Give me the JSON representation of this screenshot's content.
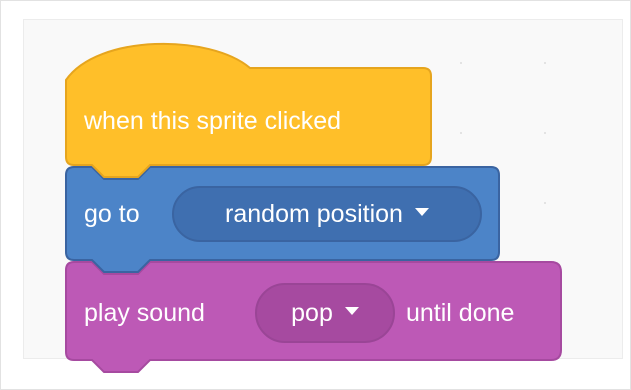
{
  "workspace": {
    "background": "#f9f9f9"
  },
  "script": {
    "hat_block": {
      "label": "when this sprite clicked",
      "color": "#ffbf29",
      "category": "events"
    },
    "goto_block": {
      "label": "go to",
      "dropdown_value": "random position",
      "color": "#4c84c8",
      "category": "motion"
    },
    "sound_block": {
      "label_before": "play sound",
      "dropdown_value": "pop",
      "label_after": "until done",
      "color": "#bd59b6",
      "category": "sound"
    }
  },
  "icons": {
    "dropdown": "dropdown-arrow-icon"
  }
}
